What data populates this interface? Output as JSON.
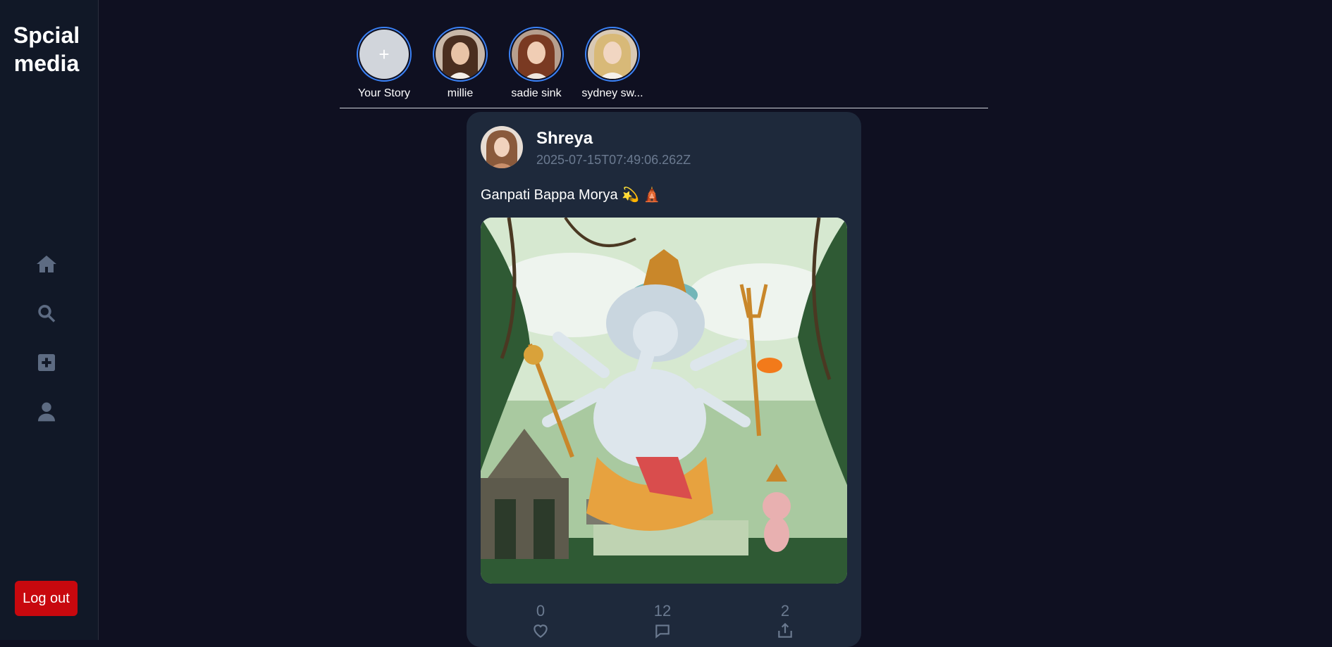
{
  "app": {
    "brand": "Spcial\nmedia"
  },
  "sidebar": {
    "nav": [
      {
        "name": "home",
        "icon": "home-icon"
      },
      {
        "name": "search",
        "icon": "search-icon"
      },
      {
        "name": "create",
        "icon": "plus-square-icon"
      },
      {
        "name": "profile",
        "icon": "user-icon"
      }
    ],
    "logout_label": "Log out"
  },
  "stories": [
    {
      "name": "Your Story",
      "add_symbol": "+"
    },
    {
      "name": "millie"
    },
    {
      "name": "sadie sink"
    },
    {
      "name": "sydney sw..."
    }
  ],
  "post": {
    "author": "Shreya",
    "timestamp": "2025-07-15T07:49:06.262Z",
    "caption": "Ganpati Bappa Morya 💫 🛕",
    "likes": "0",
    "comments": "12",
    "shares": "2"
  },
  "colors": {
    "background": "#0f1021",
    "sidebar": "#111827",
    "card": "#1e293b",
    "accent": "#3b82f6",
    "logout": "#c8080e"
  }
}
